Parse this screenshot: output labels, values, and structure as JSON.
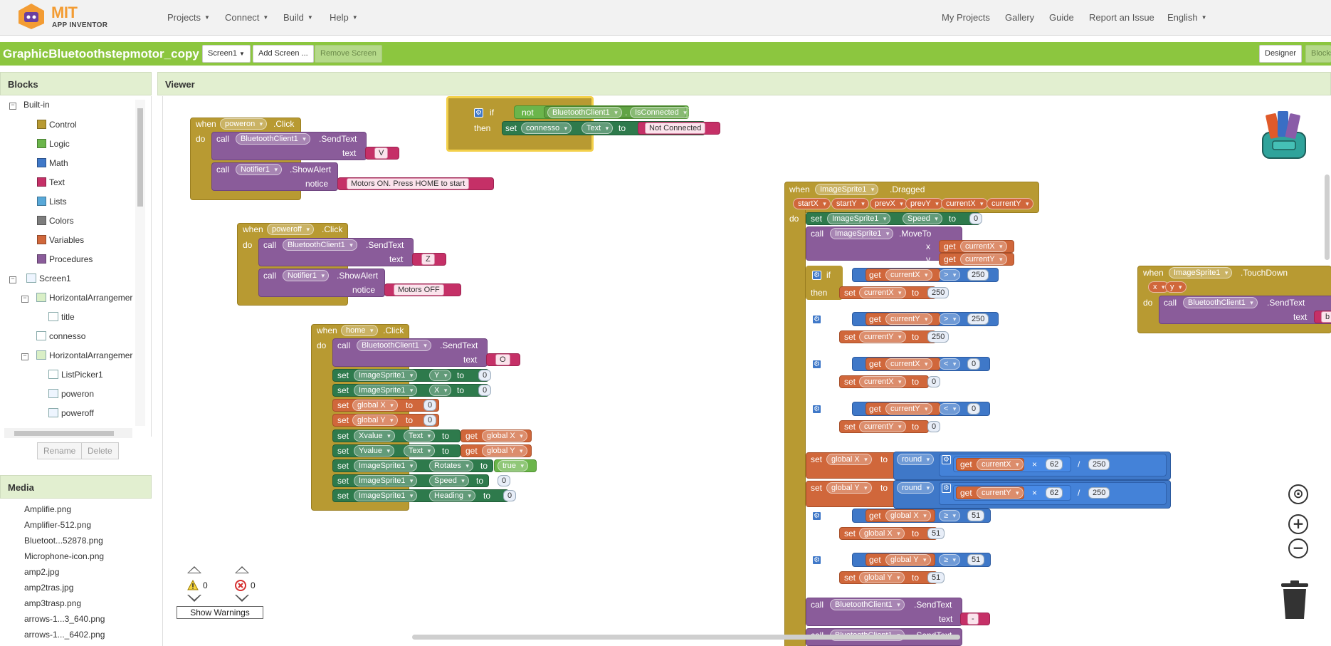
{
  "nav": {
    "logo_title": "MIT",
    "logo_subtitle": "APP INVENTOR",
    "left": [
      "Projects",
      "Connect",
      "Build",
      "Help"
    ],
    "right": [
      "My Projects",
      "Gallery",
      "Guide",
      "Report an Issue",
      "English"
    ]
  },
  "toolbar": {
    "project_name": "GraphicBluetoothstepmotor_copy",
    "screen_select": "Screen1",
    "add_screen": "Add Screen ...",
    "remove_screen": "Remove Screen",
    "designer": "Designer",
    "blocks": "Blocks"
  },
  "blocks_panel": {
    "title": "Blocks",
    "builtin_label": "Built-in",
    "builtin": [
      {
        "label": "Control",
        "color": "#b89a32"
      },
      {
        "label": "Logic",
        "color": "#6bb54b"
      },
      {
        "label": "Math",
        "color": "#3f78c8"
      },
      {
        "label": "Text",
        "color": "#c53067"
      },
      {
        "label": "Lists",
        "color": "#58a8d8"
      },
      {
        "label": "Colors",
        "color": "#7d7d7d"
      },
      {
        "label": "Variables",
        "color": "#d0673b"
      },
      {
        "label": "Procedures",
        "color": "#8a5c9a"
      }
    ],
    "screen": "Screen1",
    "components": [
      "HorizontalArrangemer",
      "title",
      "connesso",
      "HorizontalArrangemer",
      "ListPicker1",
      "poweron",
      "poweroff"
    ],
    "rename": "Rename",
    "delete": "Delete"
  },
  "media_panel": {
    "title": "Media",
    "items": [
      "Amplifie.png",
      "Amplifier-512.png",
      "Bluetoot...52878.png",
      "Microphone-icon.png",
      "amp2.jpg",
      "amp2tras.jpg",
      "amp3trasp.png",
      "arrows-1...3_640.png",
      "arrows-1..._6402.png"
    ]
  },
  "viewer": {
    "title": "Viewer",
    "warnings_count": "0",
    "errors_count": "0",
    "show_warnings": "Show Warnings"
  },
  "blocks": {
    "when": "when",
    "do": "do",
    "call": "call",
    "set": "set",
    "get": "get",
    "to": "to",
    "if": "if",
    "then": "then",
    "not": "not",
    "round": "round",
    "text_label": "text",
    "notice_label": "notice",
    "x_label": "x",
    "y_label": "y",
    "click": ".Click",
    "sendtext": ".SendText",
    "showalert": ".ShowAlert",
    "dragged": ".Dragged",
    "moveto": ".MoveTo",
    "touchdown": ".TouchDown",
    "bt": "BluetoothClient1",
    "notifier": "Notifier1",
    "sprite": "ImageSprite1",
    "poweron": "poweron",
    "poweroff": "poweroff",
    "home": "home",
    "str_V": "V",
    "str_Z": "Z",
    "str_O": "O",
    "msg_on": "Motors ON. Press HOME to start",
    "msg_off": "Motors OFF",
    "isconnected": "IsConnected",
    "connesso": "connesso",
    "Text": "Text",
    "not_connected": "Not Connected",
    "Y": "Y",
    "X": "X",
    "globalX": "global X",
    "globalY": "global Y",
    "xvalue": "Xvalue",
    "yvalue": "Yvalue",
    "rotates": "Rotates",
    "speed": "Speed",
    "heading": "Heading",
    "true": "true",
    "startX": "startX",
    "startY": "startY",
    "prevX": "prevX",
    "prevY": "prevY",
    "currentX": "currentX",
    "currentY": "currentY",
    "gt": ">",
    "lt": "<",
    "ge": "≥",
    "times": "×",
    "div": "/",
    "n0": "0",
    "n250": "250",
    "n62": "62",
    "n51": "51",
    "x": "x",
    "y": "y",
    "dash": "-",
    "b_letter": "b"
  }
}
